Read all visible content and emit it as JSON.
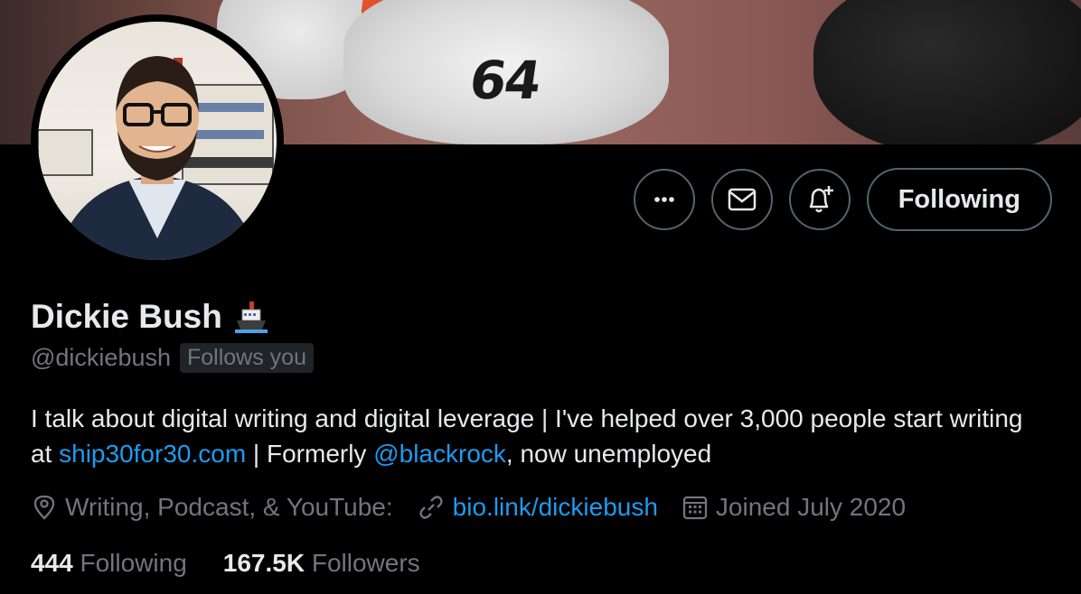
{
  "profile": {
    "display_name": "Dickie Bush",
    "name_emoji": "ship-emoji",
    "handle": "@dickiebush",
    "follows_you": "Follows you"
  },
  "actions": {
    "more_icon": "more-horizontal-icon",
    "message_icon": "envelope-icon",
    "notify_icon": "bell-plus-icon",
    "following_label": "Following"
  },
  "bio": {
    "part1": "I talk about digital writing and digital leverage | I've helped over 3,000 people start writing at ",
    "link1": "ship30for30.com",
    "part2": " | Formerly ",
    "mention": "@blackrock",
    "part3": ", now unemployed"
  },
  "meta": {
    "location": "Writing, Podcast, & YouTube:",
    "website": "bio.link/dickiebush",
    "joined": "Joined July 2020"
  },
  "stats": {
    "following_count": "444",
    "following_label": "Following",
    "followers_count": "167.5K",
    "followers_label": "Followers"
  },
  "colors": {
    "background": "#000000",
    "text": "#e7e9ea",
    "secondary": "#71767b",
    "link": "#1d9bf0",
    "border": "#536471"
  }
}
